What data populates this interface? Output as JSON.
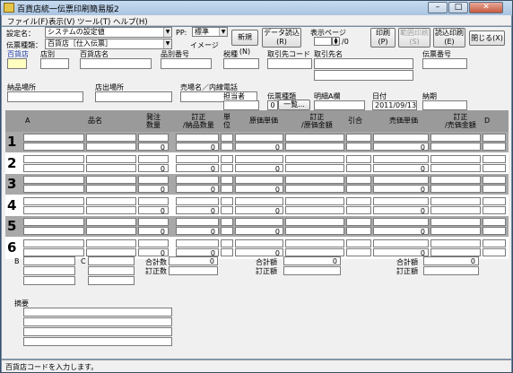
{
  "window": {
    "title": "百貨店統一伝票印刷簡易版2"
  },
  "menu": [
    "ファイル(F)",
    "表示(V)",
    "ツール(T)",
    "ヘルプ(H)"
  ],
  "toolbar": {
    "setting_label": "設定名：",
    "setting_value": "システムの設定値",
    "pp_label": "PP:",
    "pp_value": "標準",
    "voucher_type_label": "伝票種類：",
    "voucher_type_value": "百貨店［仕入伝票］",
    "image_label": "イメージ",
    "new_button": "新規(N)",
    "data_load_button": "データ読込\n(R)",
    "display_page_label": "表示ページ",
    "page_value": "",
    "page_total": "/0",
    "print_button": "印刷\n(P)",
    "range_print_button": "範囲印刷\n(S)",
    "batch_print_button": "読込印刷\n(E)",
    "close_button": "閉じる(X)"
  },
  "header_fields": {
    "dept_store": "百貨店",
    "store_code": "店別",
    "dept_store_name": "百貨店名",
    "item_number": "品別番号",
    "tax": "税種",
    "supplier_code": "取引先コード",
    "supplier_name": "取引先名",
    "voucher_number": "伝票番号",
    "delivery_location": "納品場所",
    "store_exit_location": "店出場所",
    "floor_phone": "売場名／内線電話",
    "person_in_charge": "担当者",
    "voucher_kind": "伝票種類",
    "voucher_kind_value": "0",
    "list_button": "一覧...",
    "detail_ab": "明細A欄",
    "date": "日付",
    "date_value": "2011/09/13",
    "delivery_deadline": "納期"
  },
  "grid": {
    "headers": {
      "a": "A",
      "item_name": "品名",
      "order_qty": "発注\n数量",
      "corrected_qty": "訂正\n/納品数量",
      "unit": "単\n位",
      "cost_price": "原価単価",
      "corrected_cost": "訂正\n/原価金額",
      "discount": "引合",
      "sale_price": "売価単価",
      "corrected_sale": "訂正\n/売価金額",
      "d": "D"
    },
    "rows": [
      {
        "num": "1",
        "qty": "0",
        "nq": "0",
        "cost": "0",
        "sale": "0"
      },
      {
        "num": "2",
        "qty": "0",
        "nq": "0",
        "cost": "0",
        "sale": "0"
      },
      {
        "num": "3",
        "qty": "0",
        "nq": "0",
        "cost": "0",
        "sale": "0"
      },
      {
        "num": "4",
        "qty": "0",
        "nq": "0",
        "cost": "0",
        "sale": "0"
      },
      {
        "num": "5",
        "qty": "0",
        "nq": "0",
        "cost": "0",
        "sale": "0"
      },
      {
        "num": "6",
        "qty": "0",
        "nq": "0",
        "cost": "0",
        "sale": "0"
      }
    ]
  },
  "footer": {
    "b": "B",
    "c": "C",
    "total_qty": "合計数",
    "corrected_qty": "訂正数",
    "total_amount_1": "合計額",
    "corrected_amount_1": "訂正額",
    "total_amount_2": "合計額",
    "corrected_amount_2": "訂正額",
    "zero": "0",
    "remarks": "摘要"
  },
  "status": {
    "text": "百貨店コードを入力します。"
  }
}
